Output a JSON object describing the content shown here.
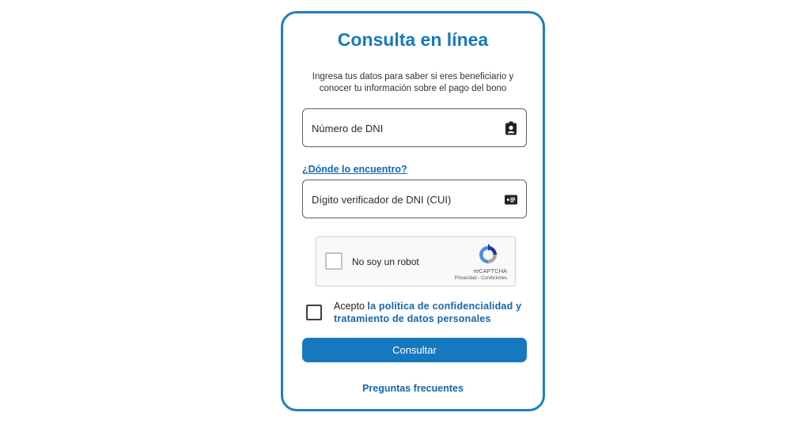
{
  "form": {
    "title": "Consulta en línea",
    "subtitle_line1": "Ingresa tus datos para saber si eres beneficiario y",
    "subtitle_line2": "conocer tu información sobre el pago del bono",
    "dni_field": {
      "placeholder": "Número de DNI",
      "value": "",
      "icon": "id-badge-icon"
    },
    "help_link": "¿Dónde lo encuentro?",
    "cui_field": {
      "placeholder": "Dígito verificador de DNI (CUI)",
      "value": "",
      "icon": "id-card-icon"
    },
    "captcha": {
      "label": "No soy un robot",
      "brand": "reCAPTCHA",
      "terms": "Privacidad - Condiciones",
      "checked": false
    },
    "terms": {
      "prefix": "Acepto",
      "link": "la política de confidencialidad y tratamiento de datos personales",
      "checked": false
    },
    "submit_label": "Consultar",
    "faq_link": "Preguntas frecuentes"
  },
  "colors": {
    "accent": "#1679bf",
    "border": "#1f7fc3",
    "link": "#1566b2"
  }
}
